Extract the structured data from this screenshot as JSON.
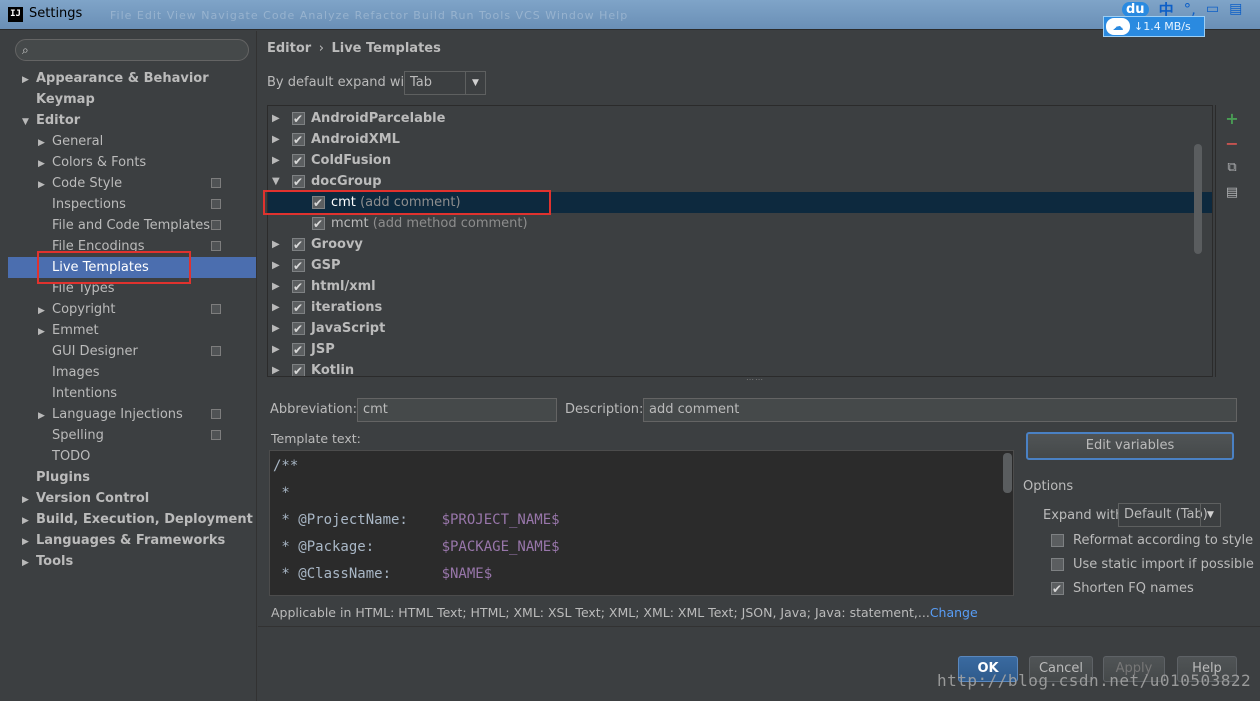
{
  "window": {
    "title": "Settings",
    "app_icon": "IJ",
    "ghost_menu": "File  Edit  View  Navigate  Code  Analyze  Refactor  Build  Run  Tools  VCS  Window  Help"
  },
  "tray": {
    "speed": "1.4 MB/s",
    "cloud_label": "du",
    "ime": "中"
  },
  "search": {
    "placeholder": ""
  },
  "nav": [
    {
      "label": "Appearance & Behavior",
      "indent": 0,
      "arrow": "right",
      "bold": true,
      "icon": false,
      "selected": false
    },
    {
      "label": "Keymap",
      "indent": 0,
      "arrow": "",
      "bold": true,
      "icon": false,
      "selected": false
    },
    {
      "label": "Editor",
      "indent": 0,
      "arrow": "down",
      "bold": true,
      "icon": false,
      "selected": false
    },
    {
      "label": "General",
      "indent": 1,
      "arrow": "right",
      "bold": false,
      "icon": false,
      "selected": false
    },
    {
      "label": "Colors & Fonts",
      "indent": 1,
      "arrow": "right",
      "bold": false,
      "icon": false,
      "selected": false
    },
    {
      "label": "Code Style",
      "indent": 1,
      "arrow": "right",
      "bold": false,
      "icon": true,
      "selected": false
    },
    {
      "label": "Inspections",
      "indent": 1,
      "arrow": "",
      "bold": false,
      "icon": true,
      "selected": false
    },
    {
      "label": "File and Code Templates",
      "indent": 1,
      "arrow": "",
      "bold": false,
      "icon": true,
      "selected": false
    },
    {
      "label": "File Encodings",
      "indent": 1,
      "arrow": "",
      "bold": false,
      "icon": true,
      "selected": false
    },
    {
      "label": "Live Templates",
      "indent": 1,
      "arrow": "",
      "bold": false,
      "icon": false,
      "selected": true
    },
    {
      "label": "File Types",
      "indent": 1,
      "arrow": "",
      "bold": false,
      "icon": false,
      "selected": false
    },
    {
      "label": "Copyright",
      "indent": 1,
      "arrow": "right",
      "bold": false,
      "icon": true,
      "selected": false
    },
    {
      "label": "Emmet",
      "indent": 1,
      "arrow": "right",
      "bold": false,
      "icon": false,
      "selected": false
    },
    {
      "label": "GUI Designer",
      "indent": 1,
      "arrow": "",
      "bold": false,
      "icon": true,
      "selected": false
    },
    {
      "label": "Images",
      "indent": 1,
      "arrow": "",
      "bold": false,
      "icon": false,
      "selected": false
    },
    {
      "label": "Intentions",
      "indent": 1,
      "arrow": "",
      "bold": false,
      "icon": false,
      "selected": false
    },
    {
      "label": "Language Injections",
      "indent": 1,
      "arrow": "right",
      "bold": false,
      "icon": true,
      "selected": false
    },
    {
      "label": "Spelling",
      "indent": 1,
      "arrow": "",
      "bold": false,
      "icon": true,
      "selected": false
    },
    {
      "label": "TODO",
      "indent": 1,
      "arrow": "",
      "bold": false,
      "icon": false,
      "selected": false
    },
    {
      "label": "Plugins",
      "indent": 0,
      "arrow": "",
      "bold": true,
      "icon": false,
      "selected": false
    },
    {
      "label": "Version Control",
      "indent": 0,
      "arrow": "right",
      "bold": true,
      "icon": false,
      "selected": false
    },
    {
      "label": "Build, Execution, Deployment",
      "indent": 0,
      "arrow": "right",
      "bold": true,
      "icon": false,
      "selected": false
    },
    {
      "label": "Languages & Frameworks",
      "indent": 0,
      "arrow": "right",
      "bold": true,
      "icon": false,
      "selected": false
    },
    {
      "label": "Tools",
      "indent": 0,
      "arrow": "right",
      "bold": true,
      "icon": false,
      "selected": false
    }
  ],
  "breadcrumb": {
    "parent": "Editor",
    "separator": "›",
    "current": "Live Templates"
  },
  "expand_default": {
    "label": "By default expand with",
    "value": "Tab"
  },
  "templates": [
    {
      "kind": "group",
      "name": "AndroidParcelable",
      "expanded": false,
      "checked": true
    },
    {
      "kind": "group",
      "name": "AndroidXML",
      "expanded": false,
      "checked": true
    },
    {
      "kind": "group",
      "name": "ColdFusion",
      "expanded": false,
      "checked": true
    },
    {
      "kind": "group",
      "name": "docGroup",
      "expanded": true,
      "checked": true
    },
    {
      "kind": "leaf",
      "name": "cmt",
      "desc": "(add comment)",
      "checked": true,
      "selected": true
    },
    {
      "kind": "leaf",
      "name": "mcmt",
      "desc": "(add method comment)",
      "checked": true,
      "selected": false
    },
    {
      "kind": "group",
      "name": "Groovy",
      "expanded": false,
      "checked": true
    },
    {
      "kind": "group",
      "name": "GSP",
      "expanded": false,
      "checked": true
    },
    {
      "kind": "group",
      "name": "html/xml",
      "expanded": false,
      "checked": true
    },
    {
      "kind": "group",
      "name": "iterations",
      "expanded": false,
      "checked": true
    },
    {
      "kind": "group",
      "name": "JavaScript",
      "expanded": false,
      "checked": true
    },
    {
      "kind": "group",
      "name": "JSP",
      "expanded": false,
      "checked": true
    },
    {
      "kind": "group",
      "name": "Kotlin",
      "expanded": false,
      "checked": true
    }
  ],
  "toolbar": {
    "add_icon": "plus-icon",
    "remove_icon": "minus-icon",
    "copy_icon": "copy-icon",
    "group_icon": "change-context-icon"
  },
  "abbreviation": {
    "label": "Abbreviation:",
    "value": "cmt"
  },
  "description": {
    "label": "Description:",
    "value": "add comment"
  },
  "template_text": {
    "label": "Template text:",
    "lines": [
      {
        "plain": "/**",
        "var": ""
      },
      {
        "plain": " *",
        "var": ""
      },
      {
        "plain": " * @ProjectName:    ",
        "var": "$PROJECT_NAME$"
      },
      {
        "plain": " * @Package:        ",
        "var": "$PACKAGE_NAME$"
      },
      {
        "plain": " * @ClassName:      ",
        "var": "$NAME$"
      }
    ]
  },
  "edit_variables": "Edit variables",
  "options": {
    "title": "Options",
    "expand_label": "Expand with",
    "expand_value": "Default (Tab)",
    "checks": [
      {
        "label": "Reformat according to style",
        "checked": false
      },
      {
        "label": "Use static import if possible",
        "checked": false
      },
      {
        "label": "Shorten FQ names",
        "checked": true
      }
    ]
  },
  "applicable": {
    "text": "Applicable in HTML: HTML Text; HTML; XML: XSL Text; XML; XML: XML Text; JSON, Java; Java: statement,...",
    "link": "Change"
  },
  "buttons": {
    "ok": "OK",
    "cancel": "Cancel",
    "apply": "Apply",
    "help": "Help"
  },
  "watermark": "http://blog.csdn.net/u010503822"
}
